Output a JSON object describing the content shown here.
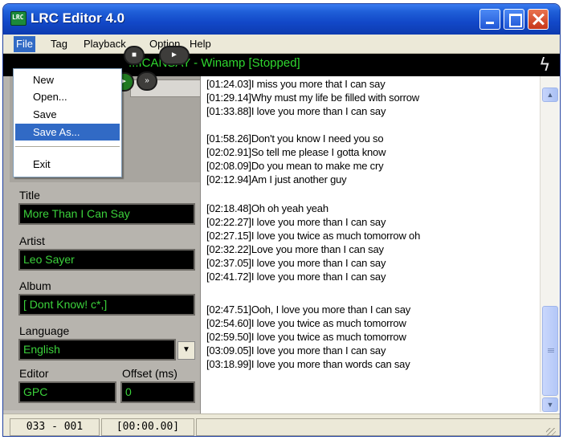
{
  "window": {
    "title": "LRC Editor 4.0",
    "app_icon_text": "LRC"
  },
  "menubar": {
    "items": [
      "File",
      "Tag",
      "Playback",
      "Option",
      "Help"
    ]
  },
  "file_menu": {
    "items": [
      "New",
      "Open...",
      "Save",
      "Save As...",
      "Exit"
    ],
    "highlighted": "Save As..."
  },
  "player": {
    "status_text": "...ICANSAY - Winamp [Stopped]",
    "buttons": [
      "stop",
      "next",
      "play",
      "fast-forward"
    ]
  },
  "tags": {
    "title_label": "Title",
    "title_value": "More Than I Can Say",
    "artist_label": "Artist",
    "artist_value": "Leo Sayer",
    "album_label": "Album",
    "album_value": "[ Dont Know! c*,]",
    "language_label": "Language",
    "language_value": "English",
    "editor_label": "Editor",
    "editor_value": "GPC",
    "offset_label": "Offset (ms)",
    "offset_value": "0"
  },
  "lyrics": [
    "[01:24.03]I miss you more that I can say",
    "[01:29.14]Why must my life be filled with sorrow",
    "[01:33.88]I love you more than I can say",
    "",
    "[01:58.26]Don't you know I need you so",
    "[02:02.91]So tell me please I gotta know",
    "[02:08.09]Do you mean to make me cry",
    "[02:12.94]Am I just another guy",
    "",
    "[02:18.48]Oh oh yeah yeah",
    "[02:22.27]I love you more than I can say",
    "[02:27.15]I love you twice as much tomorrow oh",
    "[02:32.22]Love you more than I can say",
    "[02:37.05]I love you more than I can say",
    "[02:41.72]I love you more than I can say",
    "",
    "[02:47.51]Ooh, I love you more than I can say",
    "[02:54.60]I love you twice as much tomorrow",
    "[02:59.50]I love you twice as much tomorrow",
    "[03:09.05]I love you more than I can say",
    "[03:18.99]I love you more than words can say"
  ],
  "statusbar": {
    "line_counter": "033 - 001",
    "time": "[00:00.00]"
  },
  "colors": {
    "titlebar": "#1248c8",
    "menu_highlight": "#316ac5",
    "lcd_text": "#3bd23b",
    "lcd_background": "#000000"
  }
}
